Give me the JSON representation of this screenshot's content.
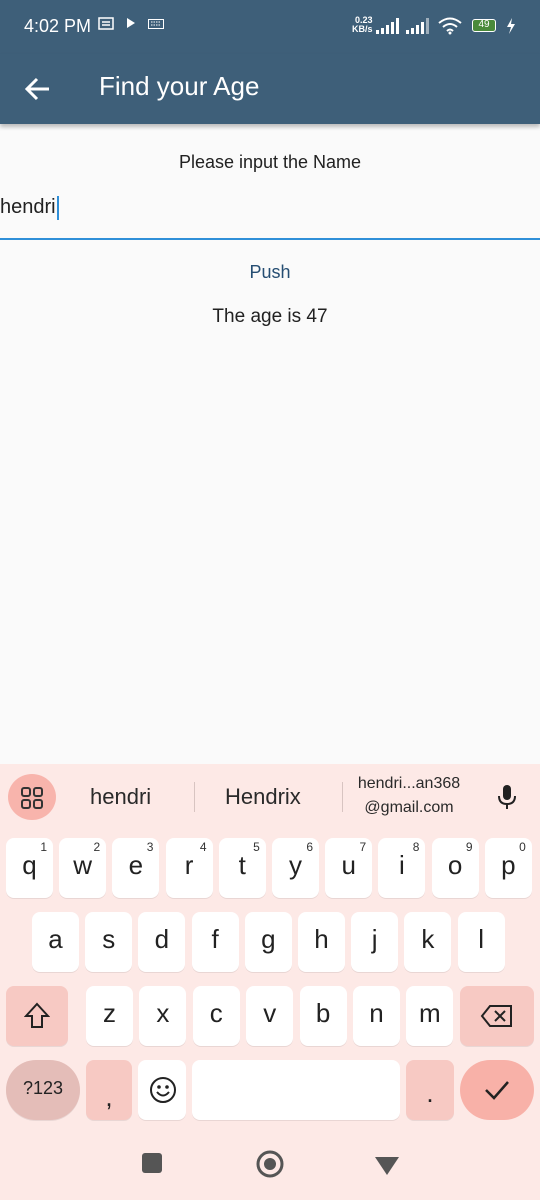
{
  "status": {
    "time": "4:02 PM",
    "net_speed_top": "0.23",
    "net_speed_unit": "KB/s",
    "battery": "49"
  },
  "appbar": {
    "title": "Find your Age"
  },
  "form": {
    "prompt": "Please input the Name",
    "name_value": "hendri",
    "push_label": "Push",
    "result": "The age is 47"
  },
  "keyboard": {
    "suggestions": [
      "hendri",
      "Hendrix"
    ],
    "email_line1": "hendri...an368",
    "email_line2": "@gmail.com",
    "row1": [
      {
        "k": "q",
        "n": "1"
      },
      {
        "k": "w",
        "n": "2"
      },
      {
        "k": "e",
        "n": "3"
      },
      {
        "k": "r",
        "n": "4"
      },
      {
        "k": "t",
        "n": "5"
      },
      {
        "k": "y",
        "n": "6"
      },
      {
        "k": "u",
        "n": "7"
      },
      {
        "k": "i",
        "n": "8"
      },
      {
        "k": "o",
        "n": "9"
      },
      {
        "k": "p",
        "n": "0"
      }
    ],
    "row2": [
      "a",
      "s",
      "d",
      "f",
      "g",
      "h",
      "j",
      "k",
      "l"
    ],
    "row3": [
      "z",
      "x",
      "c",
      "v",
      "b",
      "n",
      "m"
    ],
    "symbols_label": "?123",
    "comma": ",",
    "period": "."
  }
}
